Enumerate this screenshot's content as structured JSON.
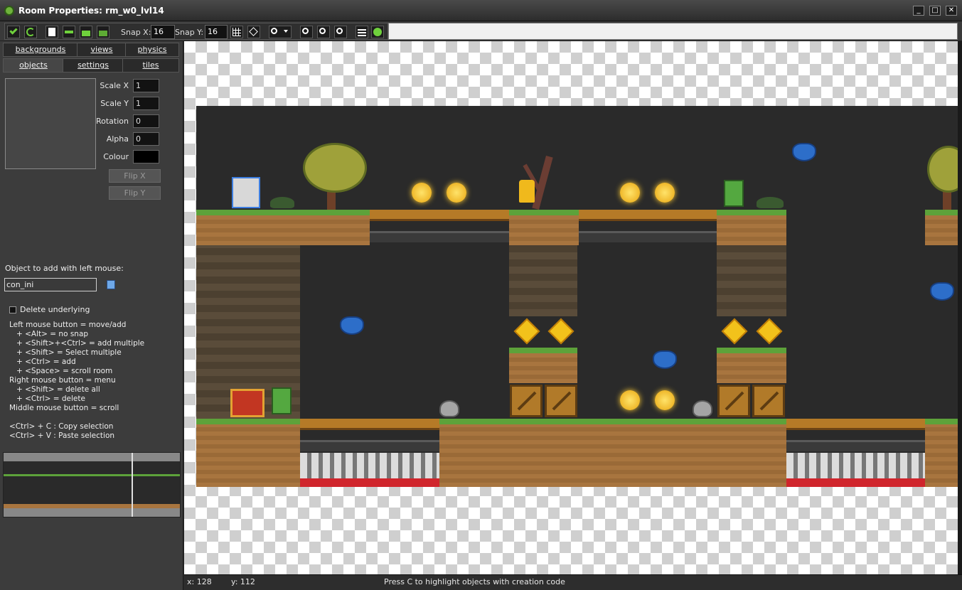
{
  "window": {
    "title": "Room Properties: rm_w0_lvl14",
    "controls": [
      "_",
      "□",
      "✕"
    ]
  },
  "toolbar": {
    "buttons": [
      "confirm-icon",
      "undo-icon",
      "new-document-icon",
      "shift-icon",
      "lock-icon",
      "unlock-icon"
    ],
    "snap_x_label": "Snap X:",
    "snap_x_value": "16",
    "snap_y_label": "Snap Y:",
    "snap_y_value": "16",
    "view_buttons": [
      "grid-icon",
      "isometric-grid-icon",
      "zoom-dropdown-icon",
      "zoom-in-icon",
      "zoom-out-icon",
      "zoom-reset-icon",
      "list-icon",
      "help-icon"
    ]
  },
  "tabs": {
    "row1": [
      "backgrounds",
      "views",
      "physics"
    ],
    "row2": [
      "objects",
      "settings",
      "tiles"
    ],
    "active": "objects"
  },
  "properties": {
    "scale_x_label": "Scale X",
    "scale_x_value": "1",
    "scale_y_label": "Scale Y",
    "scale_y_value": "1",
    "rotation_label": "Rotation",
    "rotation_value": "0",
    "alpha_label": "Alpha",
    "alpha_value": "0",
    "colour_label": "Colour",
    "colour_value": "#000000",
    "flip_x_label": "Flip X",
    "flip_y_label": "Flip Y"
  },
  "object_select": {
    "label": "Object to add with left mouse:",
    "value": "con_ini"
  },
  "delete_underlying": {
    "label": "Delete underlying",
    "checked": false
  },
  "help_lines": [
    "Left mouse button = move/add",
    "+ <Alt> = no snap",
    "+ <Shift>+<Ctrl> = add multiple",
    "+ <Shift> = Select multiple",
    "+ <Ctrl> = add",
    "+ <Space> = scroll room",
    "Right mouse button = menu",
    "+ <Shift> = delete all",
    "+ <Ctrl> = delete",
    "Middle mouse button = scroll",
    "<Ctrl> + C : Copy selection",
    "<Ctrl> + V : Paste selection"
  ],
  "status": {
    "x": "x: 128",
    "y": "y: 112",
    "message": "Press C to highlight objects with creation code"
  },
  "colors": {
    "grass": "#5da23a",
    "dirt": "#a8753f",
    "coin": "#f2c21b",
    "enemy_bat": "#2d6ec9",
    "enemy_orc": "#54a840",
    "lava": "#d0252c"
  }
}
